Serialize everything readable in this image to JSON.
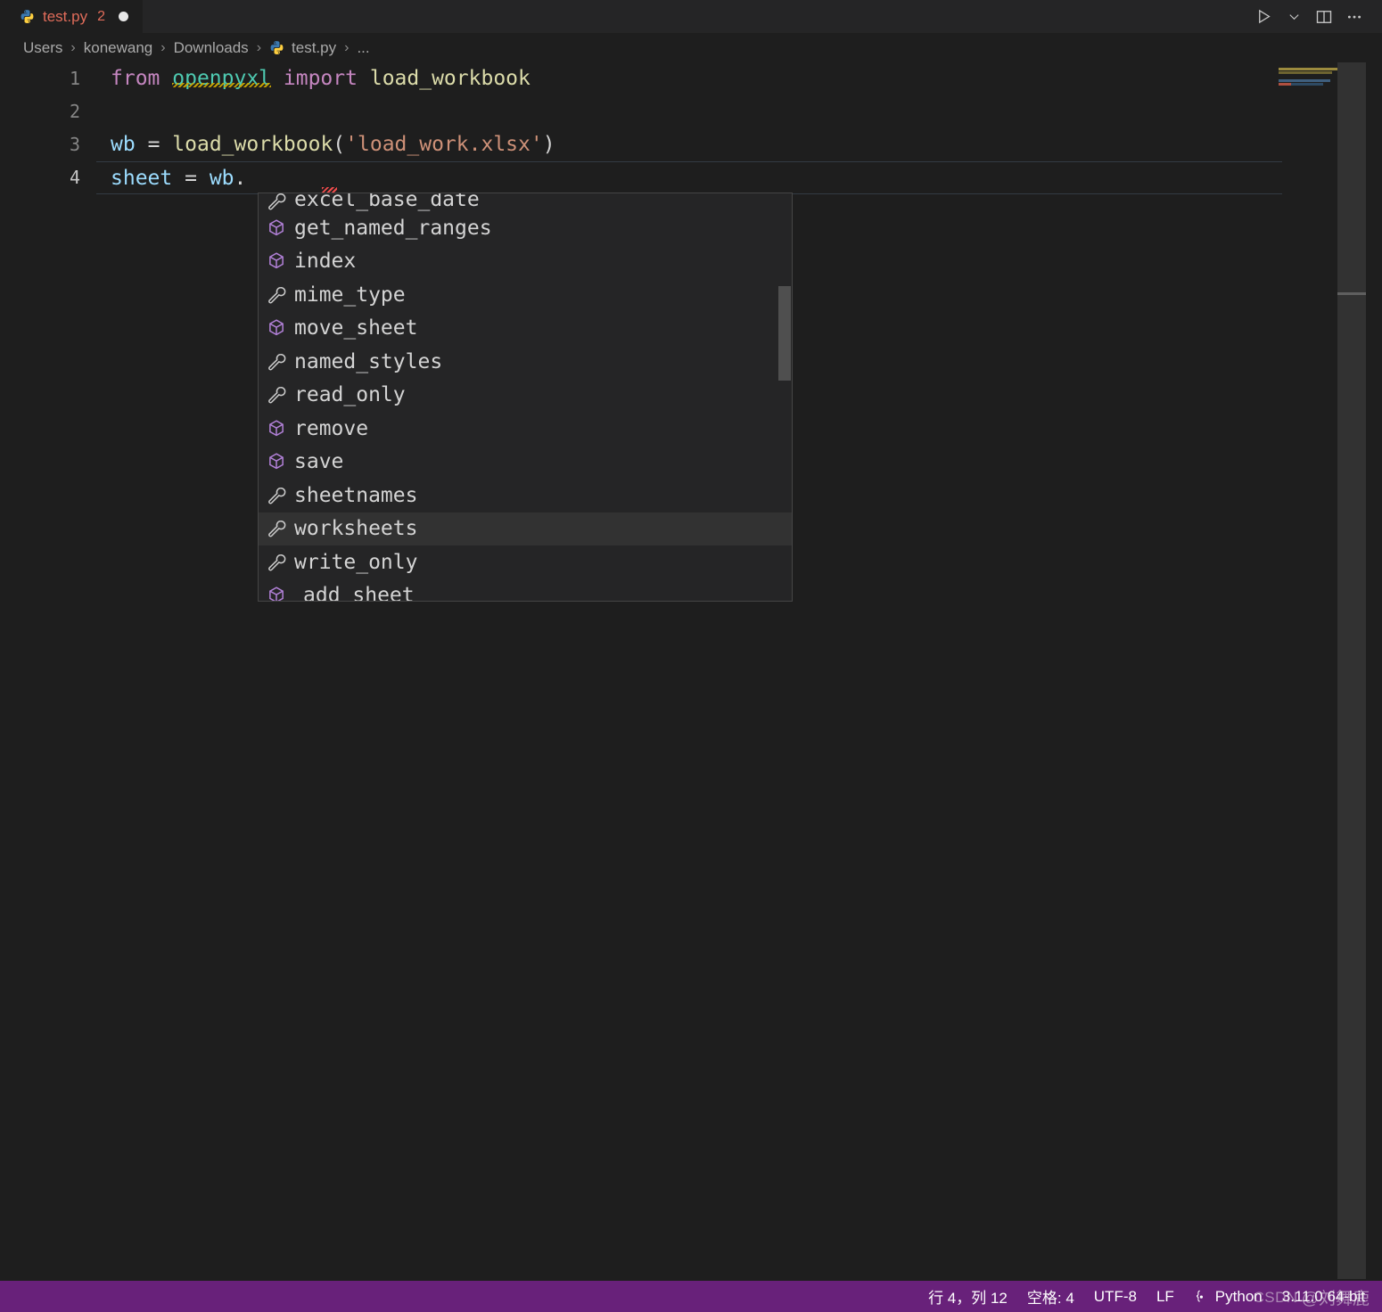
{
  "window": {
    "tab": {
      "icon": "python-file-icon",
      "label": "test.py",
      "problem_count": "2",
      "dirty_indicator": "unsaved-dot"
    },
    "actions": [
      {
        "name": "run-python-file-button",
        "icon": "play-icon"
      },
      {
        "name": "run-options-chevron",
        "icon": "chevron-down-icon"
      },
      {
        "name": "split-editor-right-button",
        "icon": "split-editor-icon"
      },
      {
        "name": "more-actions-button",
        "icon": "ellipsis-icon"
      }
    ]
  },
  "breadcrumb": {
    "items": [
      {
        "label": "Users",
        "icon": null
      },
      {
        "label": "konewang",
        "icon": null
      },
      {
        "label": "Downloads",
        "icon": null
      },
      {
        "label": "test.py",
        "icon": "python-file-icon"
      },
      {
        "label": "...",
        "icon": null
      }
    ],
    "separator": "›"
  },
  "editor": {
    "line_numbers": [
      "1",
      "2",
      "3",
      "4"
    ],
    "active_line": "4",
    "lines": [
      {
        "number": "1",
        "tokens": [
          {
            "text": "from",
            "kind": "keyword"
          },
          {
            "text": " ",
            "kind": "plain"
          },
          {
            "text": "openpyxl",
            "kind": "module",
            "diagnostic": "warning-squiggle"
          },
          {
            "text": " ",
            "kind": "plain"
          },
          {
            "text": "import",
            "kind": "keyword"
          },
          {
            "text": " ",
            "kind": "plain"
          },
          {
            "text": "load_workbook",
            "kind": "function"
          }
        ]
      },
      {
        "number": "2",
        "tokens": []
      },
      {
        "number": "3",
        "tokens": [
          {
            "text": "wb",
            "kind": "variable"
          },
          {
            "text": " ",
            "kind": "plain"
          },
          {
            "text": "=",
            "kind": "operator"
          },
          {
            "text": " ",
            "kind": "plain"
          },
          {
            "text": "load_workbook",
            "kind": "function"
          },
          {
            "text": "(",
            "kind": "plain"
          },
          {
            "text": "'load_work.xlsx'",
            "kind": "string"
          },
          {
            "text": ")",
            "kind": "plain"
          }
        ]
      },
      {
        "number": "4",
        "tokens": [
          {
            "text": "sheet",
            "kind": "variable"
          },
          {
            "text": " ",
            "kind": "plain"
          },
          {
            "text": "=",
            "kind": "operator"
          },
          {
            "text": " ",
            "kind": "plain"
          },
          {
            "text": "wb",
            "kind": "variable"
          },
          {
            "text": ".",
            "kind": "plain",
            "diagnostic": "error-squiggle"
          }
        ]
      }
    ]
  },
  "suggest_widget": {
    "selected": "worksheets",
    "items": [
      {
        "label": "excel_base_date",
        "icon": "property-wrench-icon",
        "clipped": true
      },
      {
        "label": "get_named_ranges",
        "icon": "method-cube-icon"
      },
      {
        "label": "index",
        "icon": "method-cube-icon"
      },
      {
        "label": "mime_type",
        "icon": "property-wrench-icon"
      },
      {
        "label": "move_sheet",
        "icon": "method-cube-icon"
      },
      {
        "label": "named_styles",
        "icon": "property-wrench-icon"
      },
      {
        "label": "read_only",
        "icon": "property-wrench-icon"
      },
      {
        "label": "remove",
        "icon": "method-cube-icon"
      },
      {
        "label": "save",
        "icon": "method-cube-icon"
      },
      {
        "label": "sheetnames",
        "icon": "property-wrench-icon"
      },
      {
        "label": "worksheets",
        "icon": "property-wrench-icon",
        "selected": true
      },
      {
        "label": "write_only",
        "icon": "property-wrench-icon"
      },
      {
        "label": "add sheet",
        "icon": "method-cube-icon",
        "indent": true
      }
    ]
  },
  "statusbar": {
    "cursor_position": "行 4，列 12",
    "indentation": "空格: 4",
    "encoding": "UTF-8",
    "eol": "LF",
    "language": "Python",
    "interpreter": "3.11.0 64-bit",
    "language_icon": "python-brackets-icon",
    "background_color": "#68217a"
  },
  "watermark": {
    "site": "CSDN",
    "author": "@刘舞鹿"
  },
  "colors": {
    "editor_background": "#1e1e1e",
    "tabbar_background": "#252526",
    "suggest_background": "#252526",
    "suggest_selected": "#323232",
    "keyword": "#c586c0",
    "module": "#4ec9b0",
    "function": "#dcdcaa",
    "variable": "#9cdcfe",
    "string": "#ce9178",
    "icon_cube": "#b180d7",
    "icon_wrench": "#cccccc",
    "tab_error_text": "#e06c5a"
  }
}
